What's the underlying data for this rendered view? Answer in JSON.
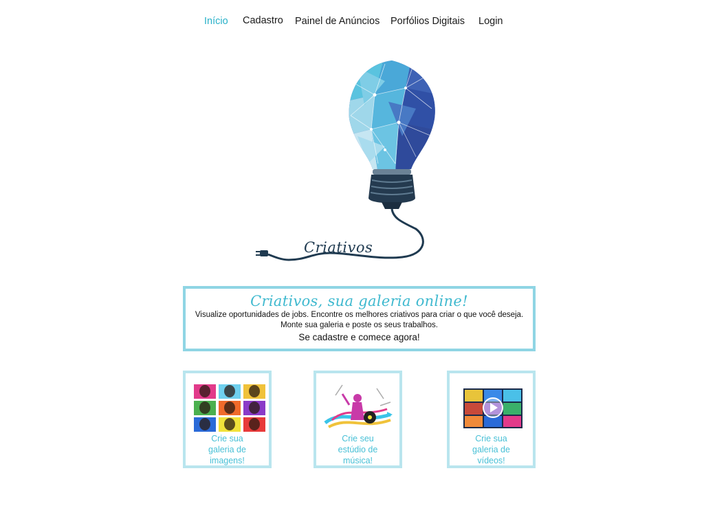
{
  "nav": {
    "items": [
      {
        "label": "Início",
        "active": true
      },
      {
        "label": "Cadastro",
        "active": false
      },
      {
        "label": "Painel de Anúncios",
        "active": false
      },
      {
        "label": "Porfólios Digitais",
        "active": false
      },
      {
        "label": "Login",
        "active": false
      }
    ],
    "active_color": "#27b0c8"
  },
  "logo": {
    "word": "Criativos"
  },
  "intro": {
    "title": "Criativos, sua galeria online!",
    "line1": "Visualize oportunidades de jobs. Encontre os melhores criativos para criar o que você deseja.",
    "line2": "Monte sua galeria e poste os seus trabalhos.",
    "line3": "Se cadastre e comece agora!"
  },
  "cards": [
    {
      "line1": "Crie sua",
      "line2": "galeria de",
      "line3": "imagens!",
      "icon": "pop-art-image"
    },
    {
      "line1": "Crie seu",
      "line2": "estúdio de",
      "line3": "música!",
      "icon": "music-art-image"
    },
    {
      "line1": "Crie sua",
      "line2": "galeria de",
      "line3": "vídeos!",
      "icon": "video-wall-image"
    }
  ],
  "colors": {
    "accent": "#3fb9cf",
    "border": "#8fd5e4",
    "card_border": "#b9e5ee"
  }
}
